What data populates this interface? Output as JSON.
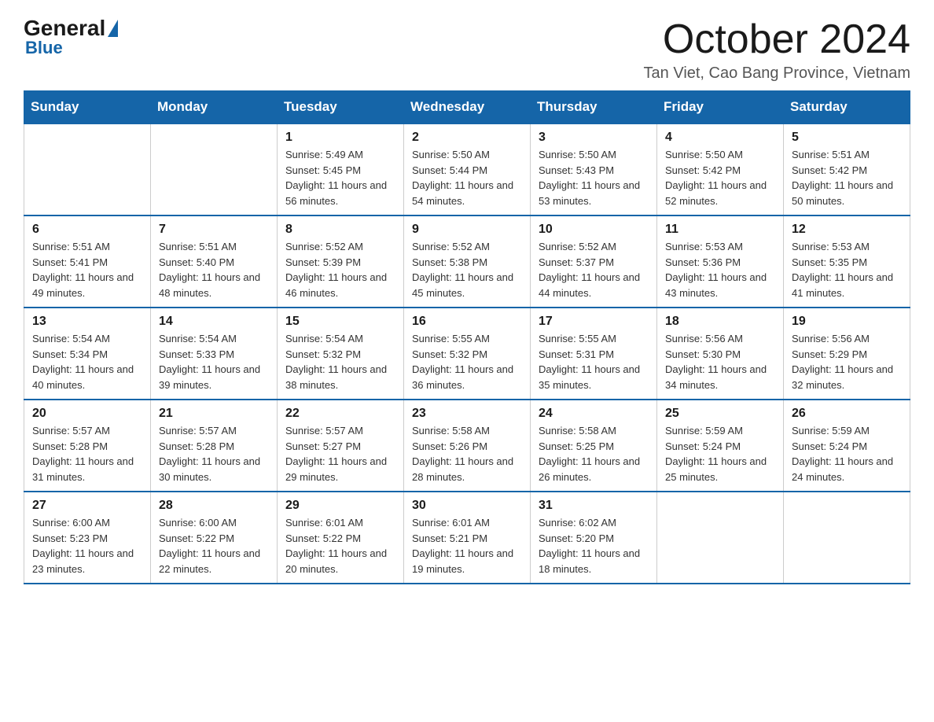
{
  "header": {
    "title": "October 2024",
    "subtitle": "Tan Viet, Cao Bang Province, Vietnam",
    "logo_general": "General",
    "logo_blue": "Blue"
  },
  "weekdays": [
    "Sunday",
    "Monday",
    "Tuesday",
    "Wednesday",
    "Thursday",
    "Friday",
    "Saturday"
  ],
  "weeks": [
    [
      {
        "day": "",
        "sunrise": "",
        "sunset": "",
        "daylight": ""
      },
      {
        "day": "",
        "sunrise": "",
        "sunset": "",
        "daylight": ""
      },
      {
        "day": "1",
        "sunrise": "Sunrise: 5:49 AM",
        "sunset": "Sunset: 5:45 PM",
        "daylight": "Daylight: 11 hours and 56 minutes."
      },
      {
        "day": "2",
        "sunrise": "Sunrise: 5:50 AM",
        "sunset": "Sunset: 5:44 PM",
        "daylight": "Daylight: 11 hours and 54 minutes."
      },
      {
        "day": "3",
        "sunrise": "Sunrise: 5:50 AM",
        "sunset": "Sunset: 5:43 PM",
        "daylight": "Daylight: 11 hours and 53 minutes."
      },
      {
        "day": "4",
        "sunrise": "Sunrise: 5:50 AM",
        "sunset": "Sunset: 5:42 PM",
        "daylight": "Daylight: 11 hours and 52 minutes."
      },
      {
        "day": "5",
        "sunrise": "Sunrise: 5:51 AM",
        "sunset": "Sunset: 5:42 PM",
        "daylight": "Daylight: 11 hours and 50 minutes."
      }
    ],
    [
      {
        "day": "6",
        "sunrise": "Sunrise: 5:51 AM",
        "sunset": "Sunset: 5:41 PM",
        "daylight": "Daylight: 11 hours and 49 minutes."
      },
      {
        "day": "7",
        "sunrise": "Sunrise: 5:51 AM",
        "sunset": "Sunset: 5:40 PM",
        "daylight": "Daylight: 11 hours and 48 minutes."
      },
      {
        "day": "8",
        "sunrise": "Sunrise: 5:52 AM",
        "sunset": "Sunset: 5:39 PM",
        "daylight": "Daylight: 11 hours and 46 minutes."
      },
      {
        "day": "9",
        "sunrise": "Sunrise: 5:52 AM",
        "sunset": "Sunset: 5:38 PM",
        "daylight": "Daylight: 11 hours and 45 minutes."
      },
      {
        "day": "10",
        "sunrise": "Sunrise: 5:52 AM",
        "sunset": "Sunset: 5:37 PM",
        "daylight": "Daylight: 11 hours and 44 minutes."
      },
      {
        "day": "11",
        "sunrise": "Sunrise: 5:53 AM",
        "sunset": "Sunset: 5:36 PM",
        "daylight": "Daylight: 11 hours and 43 minutes."
      },
      {
        "day": "12",
        "sunrise": "Sunrise: 5:53 AM",
        "sunset": "Sunset: 5:35 PM",
        "daylight": "Daylight: 11 hours and 41 minutes."
      }
    ],
    [
      {
        "day": "13",
        "sunrise": "Sunrise: 5:54 AM",
        "sunset": "Sunset: 5:34 PM",
        "daylight": "Daylight: 11 hours and 40 minutes."
      },
      {
        "day": "14",
        "sunrise": "Sunrise: 5:54 AM",
        "sunset": "Sunset: 5:33 PM",
        "daylight": "Daylight: 11 hours and 39 minutes."
      },
      {
        "day": "15",
        "sunrise": "Sunrise: 5:54 AM",
        "sunset": "Sunset: 5:32 PM",
        "daylight": "Daylight: 11 hours and 38 minutes."
      },
      {
        "day": "16",
        "sunrise": "Sunrise: 5:55 AM",
        "sunset": "Sunset: 5:32 PM",
        "daylight": "Daylight: 11 hours and 36 minutes."
      },
      {
        "day": "17",
        "sunrise": "Sunrise: 5:55 AM",
        "sunset": "Sunset: 5:31 PM",
        "daylight": "Daylight: 11 hours and 35 minutes."
      },
      {
        "day": "18",
        "sunrise": "Sunrise: 5:56 AM",
        "sunset": "Sunset: 5:30 PM",
        "daylight": "Daylight: 11 hours and 34 minutes."
      },
      {
        "day": "19",
        "sunrise": "Sunrise: 5:56 AM",
        "sunset": "Sunset: 5:29 PM",
        "daylight": "Daylight: 11 hours and 32 minutes."
      }
    ],
    [
      {
        "day": "20",
        "sunrise": "Sunrise: 5:57 AM",
        "sunset": "Sunset: 5:28 PM",
        "daylight": "Daylight: 11 hours and 31 minutes."
      },
      {
        "day": "21",
        "sunrise": "Sunrise: 5:57 AM",
        "sunset": "Sunset: 5:28 PM",
        "daylight": "Daylight: 11 hours and 30 minutes."
      },
      {
        "day": "22",
        "sunrise": "Sunrise: 5:57 AM",
        "sunset": "Sunset: 5:27 PM",
        "daylight": "Daylight: 11 hours and 29 minutes."
      },
      {
        "day": "23",
        "sunrise": "Sunrise: 5:58 AM",
        "sunset": "Sunset: 5:26 PM",
        "daylight": "Daylight: 11 hours and 28 minutes."
      },
      {
        "day": "24",
        "sunrise": "Sunrise: 5:58 AM",
        "sunset": "Sunset: 5:25 PM",
        "daylight": "Daylight: 11 hours and 26 minutes."
      },
      {
        "day": "25",
        "sunrise": "Sunrise: 5:59 AM",
        "sunset": "Sunset: 5:24 PM",
        "daylight": "Daylight: 11 hours and 25 minutes."
      },
      {
        "day": "26",
        "sunrise": "Sunrise: 5:59 AM",
        "sunset": "Sunset: 5:24 PM",
        "daylight": "Daylight: 11 hours and 24 minutes."
      }
    ],
    [
      {
        "day": "27",
        "sunrise": "Sunrise: 6:00 AM",
        "sunset": "Sunset: 5:23 PM",
        "daylight": "Daylight: 11 hours and 23 minutes."
      },
      {
        "day": "28",
        "sunrise": "Sunrise: 6:00 AM",
        "sunset": "Sunset: 5:22 PM",
        "daylight": "Daylight: 11 hours and 22 minutes."
      },
      {
        "day": "29",
        "sunrise": "Sunrise: 6:01 AM",
        "sunset": "Sunset: 5:22 PM",
        "daylight": "Daylight: 11 hours and 20 minutes."
      },
      {
        "day": "30",
        "sunrise": "Sunrise: 6:01 AM",
        "sunset": "Sunset: 5:21 PM",
        "daylight": "Daylight: 11 hours and 19 minutes."
      },
      {
        "day": "31",
        "sunrise": "Sunrise: 6:02 AM",
        "sunset": "Sunset: 5:20 PM",
        "daylight": "Daylight: 11 hours and 18 minutes."
      },
      {
        "day": "",
        "sunrise": "",
        "sunset": "",
        "daylight": ""
      },
      {
        "day": "",
        "sunrise": "",
        "sunset": "",
        "daylight": ""
      }
    ]
  ]
}
